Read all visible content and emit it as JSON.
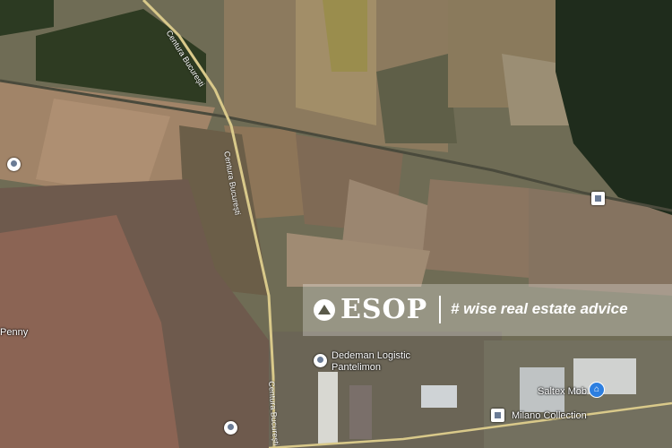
{
  "map": {
    "road_name": "Centura București",
    "pois": [
      {
        "name": "Dedeman Logistic Pantelimon",
        "line1": "Dedeman Logistic",
        "line2": "Pantelimon"
      },
      {
        "name": "Saltex Mob"
      },
      {
        "name": "Milano Collection"
      },
      {
        "name": "Penny"
      }
    ]
  },
  "banner": {
    "brand": "ESOP",
    "registered": "®",
    "tagline": "# wise real estate advice"
  }
}
